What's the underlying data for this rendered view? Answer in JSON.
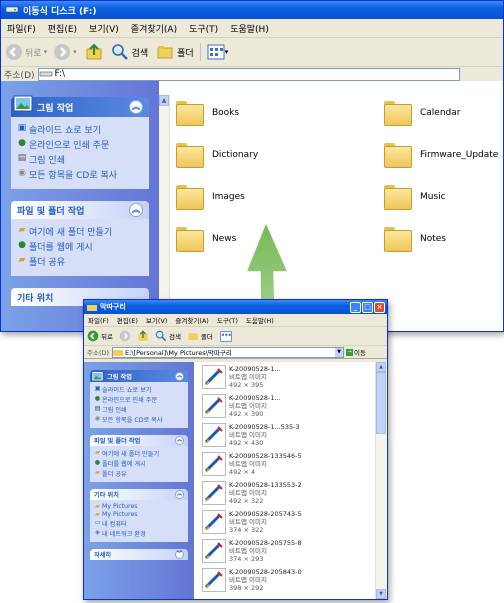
{
  "main": {
    "title": "이동식 디스크 (F:)",
    "menu": [
      "파일(F)",
      "편집(E)",
      "보기(V)",
      "즐겨찾기(A)",
      "도구(T)",
      "도움말(H)"
    ],
    "toolbar": {
      "back": "뒤로",
      "search": "검색",
      "folders": "폴더"
    },
    "address": {
      "label": "주소(D)",
      "path": "F:\\"
    },
    "sidebar": {
      "picture_tasks": {
        "title": "그림 작업",
        "items": [
          "슬라이드 쇼로 보기",
          "온라인으로 인쇄 주문",
          "그림 인쇄",
          "모든 항목을 CD로 복사"
        ]
      },
      "file_tasks": {
        "title": "파일 및 폴더 작업",
        "items": [
          "여기에 새 폴더 만들기",
          "폴더를 웹에 게시",
          "폴더 공유"
        ]
      },
      "other": {
        "title": "기타 위치"
      }
    },
    "folders": [
      "Books",
      "Calendar",
      "Dictionary",
      "Firmware_Update",
      "Images",
      "Music",
      "News",
      "Notes"
    ]
  },
  "sub": {
    "title": "막따구리",
    "menu": [
      "파일(F)",
      "편집(E)",
      "보기(V)",
      "즐겨찾기(A)",
      "도구(T)",
      "도움말(H)"
    ],
    "toolbar": {
      "back": "뒤로",
      "search": "검색",
      "folders": "폴더"
    },
    "address": {
      "label": "주소(D)",
      "path": "E:\\[Personal]\\My Pictures\\막따구리",
      "go": "이동"
    },
    "sidebar": {
      "picture_tasks": {
        "title": "그림 작업",
        "items": [
          "슬라이드 쇼로 보기",
          "온라인으로 인쇄 주문",
          "그림 인쇄",
          "모든 항목을 CD로 복사"
        ]
      },
      "file_tasks": {
        "title": "파일 및 폴더 작업",
        "items": [
          "여기에 새 폴더 만들기",
          "폴더를 웹에 게시",
          "폴더 공유"
        ]
      },
      "other": {
        "title": "기타 위치",
        "items": [
          "My Pictures",
          "My Pictures",
          "내 컴퓨터",
          "내 네트워크 환경"
        ]
      },
      "details": {
        "title": "자세히"
      }
    },
    "files": [
      {
        "name": "K-20090528-1...",
        "type": "비트맵 이미지",
        "dims": "492 × 395"
      },
      {
        "name": "K-20090528-1...",
        "type": "비트맵 이미지",
        "dims": "492 × 390"
      },
      {
        "name": "K-20090528-1...535-3",
        "type": "비트맵 이미지",
        "dims": "492 × 430"
      },
      {
        "name": "K-20090528-133546-5",
        "type": "비트맵 이미지",
        "dims": "492 × 4"
      },
      {
        "name": "K-20090528-133553-2",
        "type": "비트맵 이미지",
        "dims": "492 × 322"
      },
      {
        "name": "K-20090528-205743-5",
        "type": "비트맵 이미지",
        "dims": "374 × 322"
      },
      {
        "name": "K-20090528-205755-8",
        "type": "비트맵 이미지",
        "dims": "374 × 293"
      },
      {
        "name": "K-20090528-205843-0",
        "type": "비트맵 이미지",
        "dims": "398 × 292"
      }
    ]
  },
  "colors": {
    "xp_blue": "#0a5fe2",
    "sidebar_blue": "#6f8ee0",
    "link": "#215dc6",
    "arrow": "#7fbf5f"
  }
}
